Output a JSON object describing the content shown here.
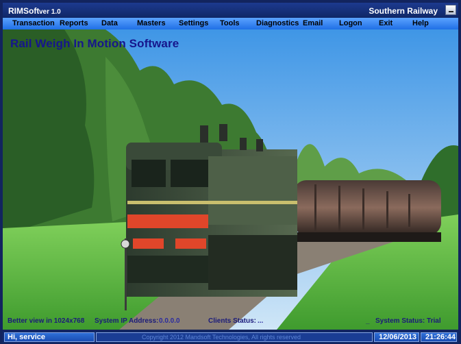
{
  "titlebar": {
    "app_name": "RIMSoft",
    "version": "ver 1.0",
    "org": "Southern Railway"
  },
  "menu": [
    "Transaction",
    "Reports",
    "Data",
    "Masters",
    "Settings",
    "Tools",
    "Diagnostics",
    "Email",
    "Logon",
    "Exit",
    "Help"
  ],
  "heading": "Rail Weigh In Motion Software",
  "info": {
    "view_hint": "Better view in 1024x768",
    "ip_label": "System IP Address:",
    "ip_value": "0.0.0.0",
    "clients_label": "Clients Status:",
    "clients_value": "...",
    "dash": "_",
    "system_status": "System Status: Trial"
  },
  "status": {
    "greeting": "Hi, service",
    "copyright": "Copyright 2012 Mandsoft Technologies, All rights reserved",
    "date": "12/06/2013",
    "time": "21:26:44"
  },
  "colors": {
    "title_bg": "#0f2766",
    "menu_bg": "#3b8cf5",
    "heading": "#16168c"
  },
  "icons": {
    "minimize": "minimize-icon"
  }
}
